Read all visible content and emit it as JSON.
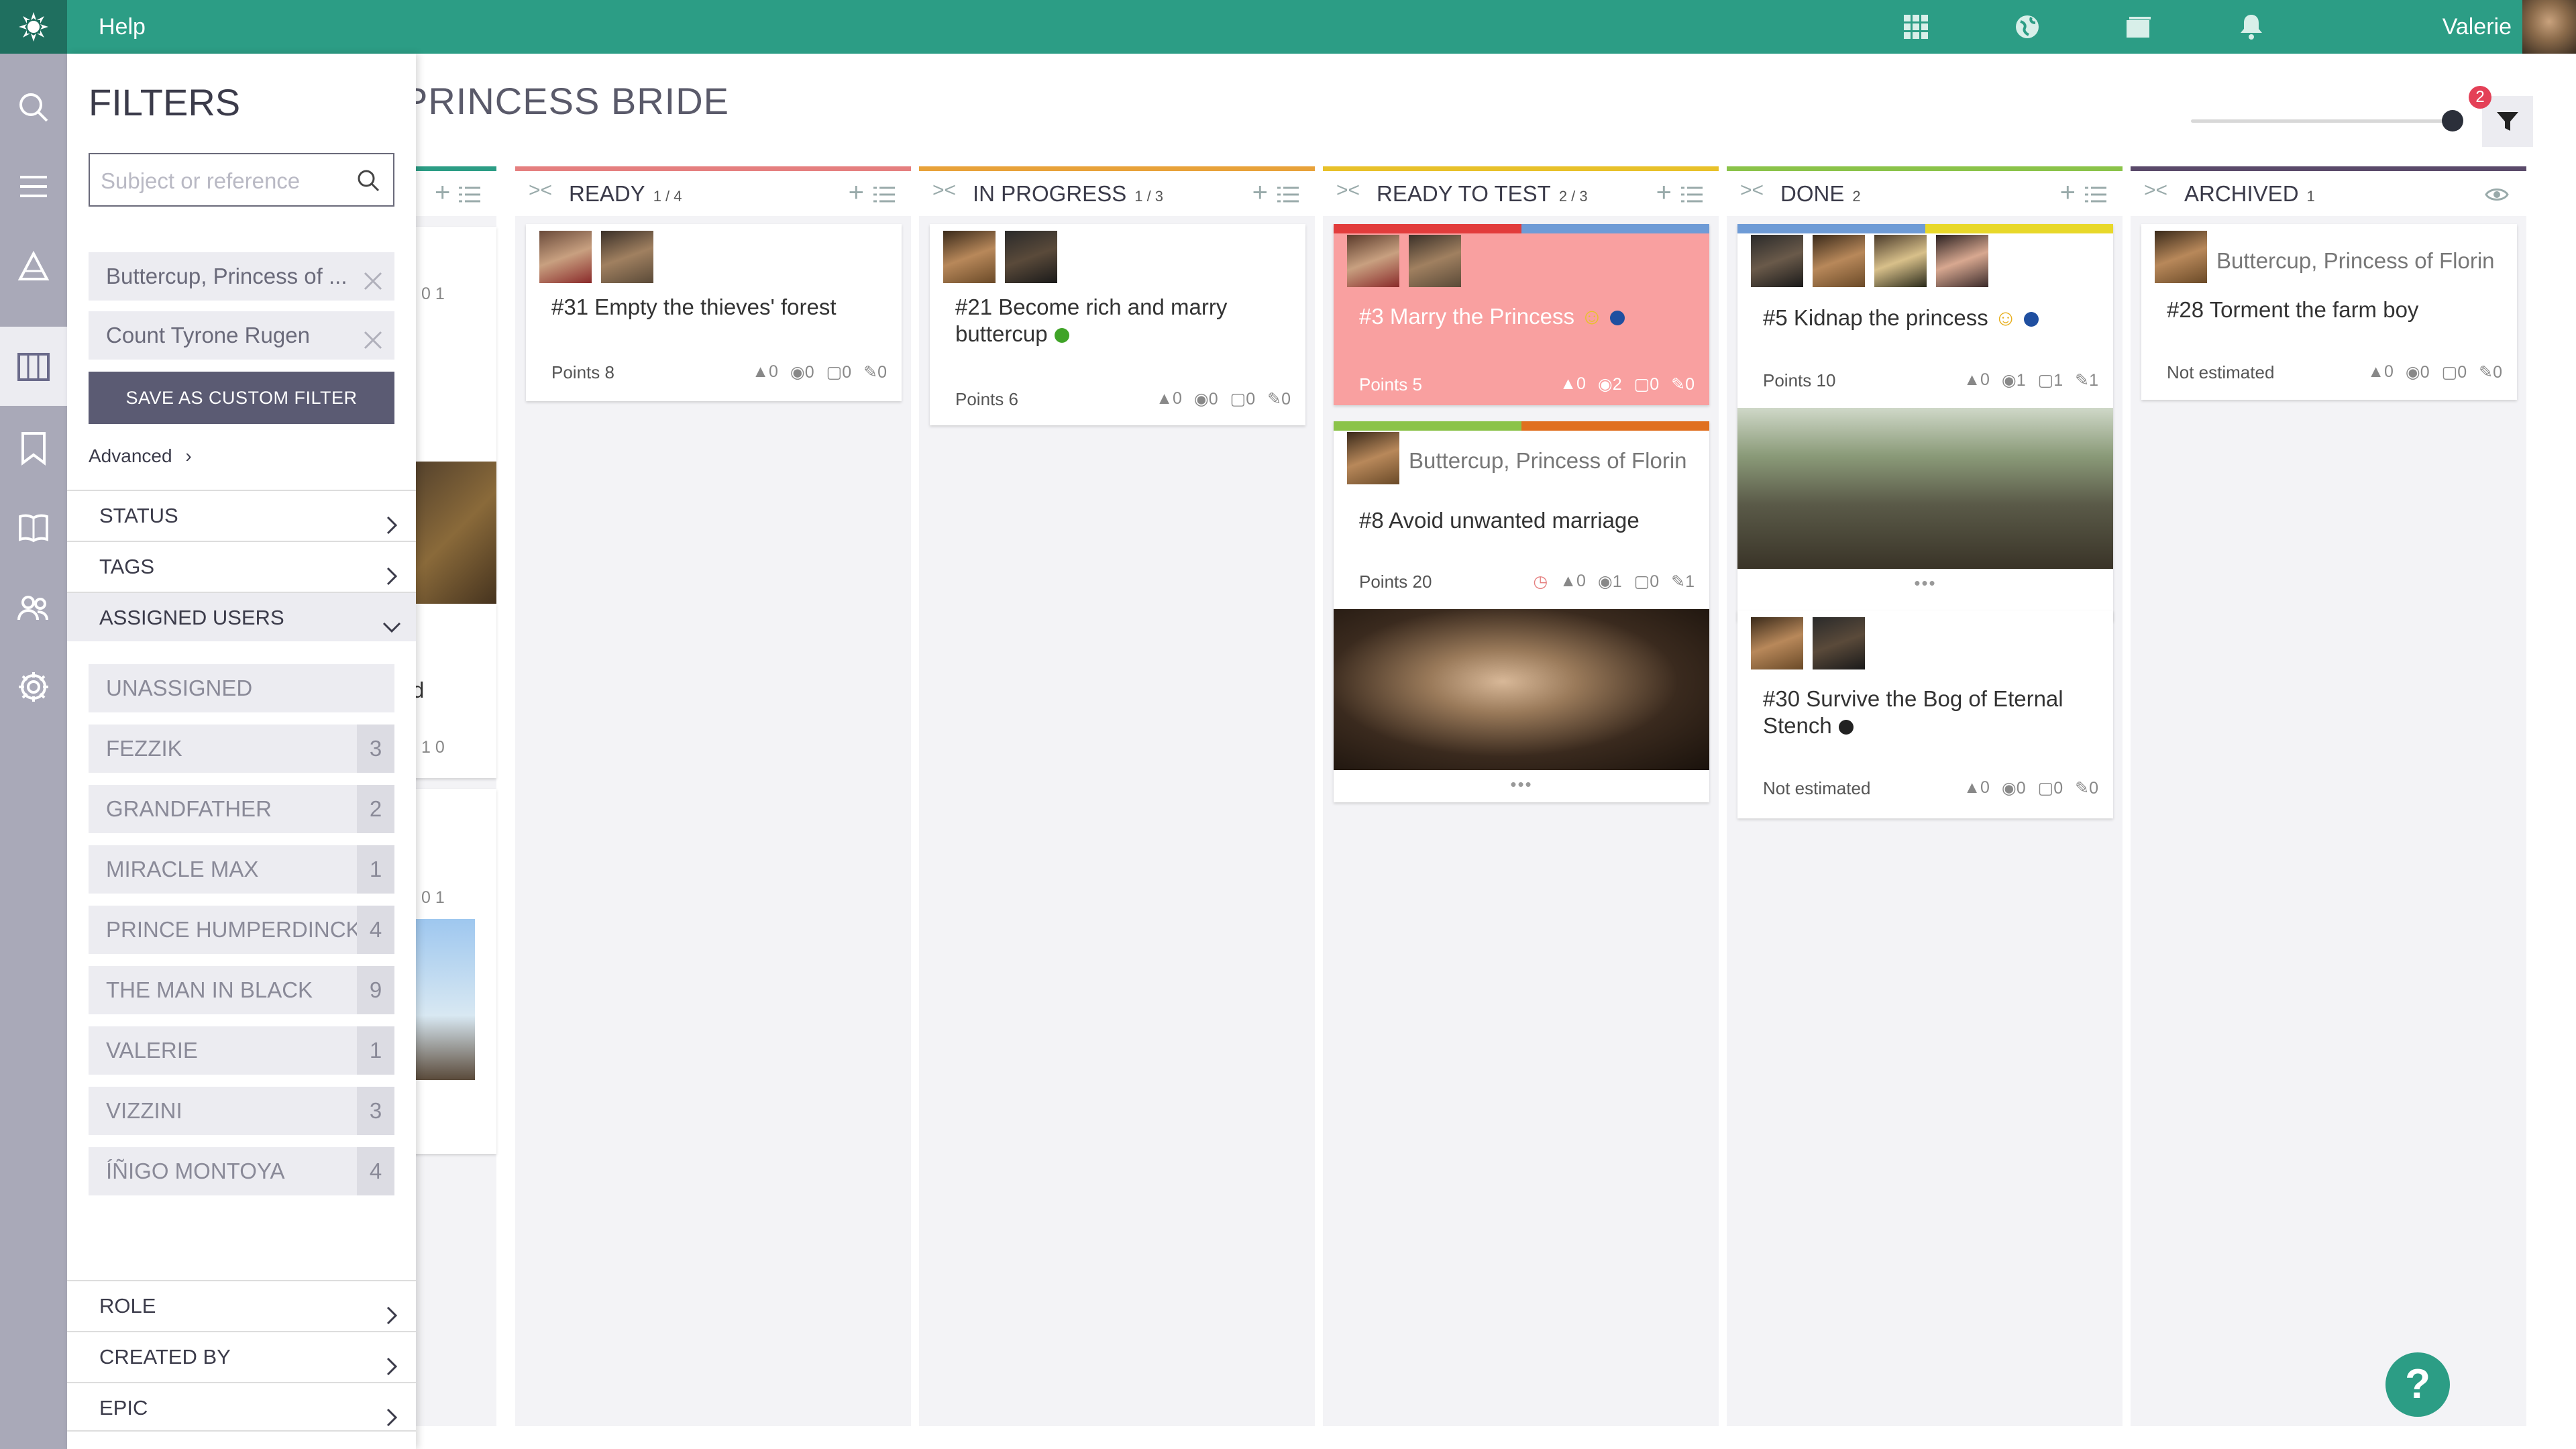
{
  "topbar": {
    "help_label": "Help",
    "user_name": "Valerie"
  },
  "page_title": "PRINCESS BRIDE",
  "filter": {
    "badge_count": "2"
  },
  "panel": {
    "title": "FILTERS",
    "search_placeholder": "Subject or reference",
    "chips": [
      "Buttercup, Princess of ...",
      "Count Tyrone Rugen"
    ],
    "save_label": "SAVE AS CUSTOM FILTER",
    "advanced_label": "Advanced",
    "sections_top": [
      "STATUS",
      "TAGS",
      "ASSIGNED USERS"
    ],
    "users": [
      {
        "name": "UNASSIGNED",
        "count": ""
      },
      {
        "name": "FEZZIK",
        "count": "3"
      },
      {
        "name": "GRANDFATHER",
        "count": "2"
      },
      {
        "name": "MIRACLE MAX",
        "count": "1"
      },
      {
        "name": "PRINCE HUMPERDINCK",
        "count": "4"
      },
      {
        "name": "THE MAN IN BLACK",
        "count": "9"
      },
      {
        "name": "VALERIE",
        "count": "1"
      },
      {
        "name": "VIZZINI",
        "count": "3"
      },
      {
        "name": "ÍÑIGO MONTOYA",
        "count": "4"
      }
    ],
    "sections_bottom": [
      "ROLE",
      "CREATED BY",
      "EPIC"
    ]
  },
  "hidden_col": {
    "stats1": "0  1",
    "frag": "d",
    "stats2": "1  0",
    "stats3": "0  1"
  },
  "columns": [
    {
      "name": "READY",
      "count": "1 / 4",
      "color": "#e57f7f"
    },
    {
      "name": "IN PROGRESS",
      "count": "1 / 3",
      "color": "#e8a23a"
    },
    {
      "name": "READY TO TEST",
      "count": "2 / 3",
      "color": "#e8c12a"
    },
    {
      "name": "DONE",
      "count": "2",
      "color": "#8bc34a"
    },
    {
      "name": "ARCHIVED",
      "count": "1",
      "color": "#5a4a6a"
    }
  ],
  "cards": {
    "c31": {
      "title": "#31 Empty the thieves' forest",
      "points": "Points 8",
      "stats": [
        "0",
        "0",
        "0",
        "0"
      ]
    },
    "c21": {
      "title": "#21 Become rich and marry buttercup",
      "points": "Points 6",
      "stats": [
        "0",
        "0",
        "0",
        "0"
      ],
      "dot": "#3fa327"
    },
    "c3": {
      "title": "#3 Marry the Princess",
      "points": "Points 5",
      "stats": [
        "0",
        "2",
        "0",
        "0"
      ],
      "dot": "#1f4fa0",
      "bg": "#f9a0a0"
    },
    "c8": {
      "epic": "Buttercup, Princess of Florin",
      "title": "#8 Avoid unwanted marriage",
      "points": "Points 20",
      "stats": [
        "0",
        "1",
        "0",
        "1"
      ]
    },
    "c5": {
      "title": "#5 Kidnap the princess",
      "points": "Points 10",
      "stats": [
        "0",
        "1",
        "1",
        "1"
      ],
      "dot": "#1f4fa0"
    },
    "c30": {
      "title": "#30 Survive the Bog of Eternal Stench",
      "points": "Not estimated",
      "stats": [
        "0",
        "0",
        "0",
        "0"
      ],
      "dot": "#222222"
    },
    "c28": {
      "epic": "Buttercup, Princess of Florin",
      "title": "#28 Torment the farm boy",
      "points": "Not estimated",
      "stats": [
        "0",
        "0",
        "0",
        "0"
      ]
    }
  },
  "help_fab": "?"
}
